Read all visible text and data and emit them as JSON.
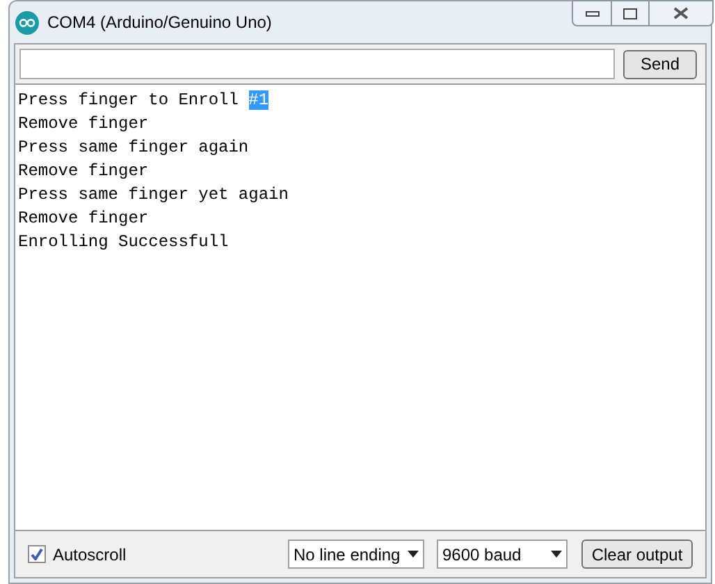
{
  "window": {
    "title": "COM4 (Arduino/Genuino Uno)"
  },
  "send_button": "Send",
  "output_lines": [
    {
      "text": "Press finger to Enroll ",
      "selected_text": "#1"
    },
    {
      "text": "Remove finger"
    },
    {
      "text": "Press same finger again"
    },
    {
      "text": "Remove finger"
    },
    {
      "text": "Press same finger yet again"
    },
    {
      "text": "Remove finger"
    },
    {
      "text": "Enrolling Successfull"
    }
  ],
  "autoscroll": {
    "label": "Autoscroll",
    "checked": true
  },
  "line_ending": "No line ending",
  "baud_rate": "9600 baud",
  "clear_button": "Clear output"
}
